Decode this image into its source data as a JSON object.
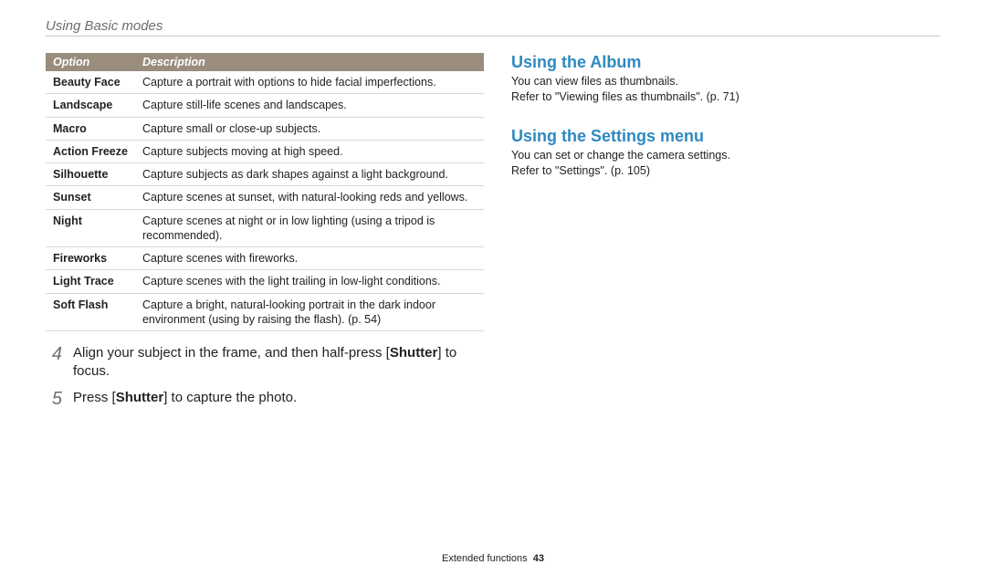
{
  "page_header": "Using Basic modes",
  "table": {
    "headers": {
      "option": "Option",
      "description": "Description"
    },
    "rows": [
      {
        "option": "Beauty Face",
        "description": "Capture a portrait with options to hide facial imperfections."
      },
      {
        "option": "Landscape",
        "description": "Capture still-life scenes and landscapes."
      },
      {
        "option": "Macro",
        "description": "Capture small or close-up subjects."
      },
      {
        "option": "Action Freeze",
        "description": "Capture subjects moving at high speed."
      },
      {
        "option": "Silhouette",
        "description": "Capture subjects as dark shapes against a light background."
      },
      {
        "option": "Sunset",
        "description": "Capture scenes at sunset, with natural-looking reds and yellows."
      },
      {
        "option": "Night",
        "description": "Capture scenes at night or in low lighting (using a tripod is recommended)."
      },
      {
        "option": "Fireworks",
        "description": "Capture scenes with fireworks."
      },
      {
        "option": "Light Trace",
        "description": "Capture scenes with the light trailing in low-light conditions."
      },
      {
        "option": "Soft Flash",
        "description": "Capture a bright, natural-looking portrait in the dark indoor environment (using by raising the flash). (p. 54)"
      }
    ]
  },
  "steps": {
    "s4": {
      "num": "4",
      "pre": "Align your subject in the frame, and then half-press [",
      "bold": "Shutter",
      "post": "] to focus."
    },
    "s5": {
      "num": "5",
      "pre": "Press [",
      "bold": "Shutter",
      "post": "] to capture the photo."
    }
  },
  "right": {
    "album": {
      "heading": "Using the Album",
      "line1": "You can view files as thumbnails.",
      "line2": "Refer to \"Viewing files as thumbnails\". (p. 71)"
    },
    "settings": {
      "heading": "Using the Settings menu",
      "line1": "You can set or change the camera settings.",
      "line2": "Refer to \"Settings\". (p. 105)"
    }
  },
  "footer": {
    "section": "Extended functions",
    "page": "43"
  }
}
